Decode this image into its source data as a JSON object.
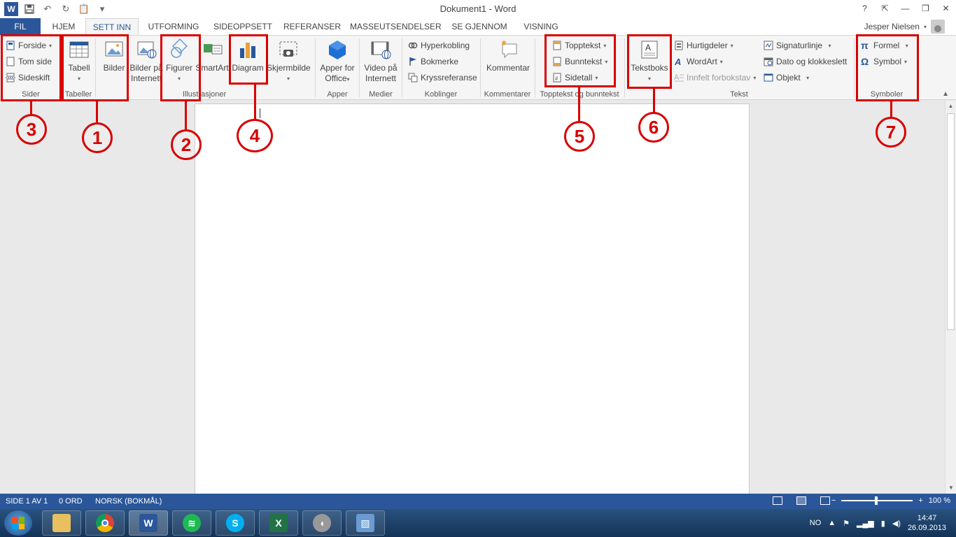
{
  "titlebar": {
    "title": "Dokument1 - Word",
    "help": "?",
    "min": "—",
    "restore": "❐",
    "close": "✕"
  },
  "tabs": {
    "file": "FIL",
    "items": [
      "HJEM",
      "SETT INN",
      "UTFORMING",
      "SIDEOPPSETT",
      "REFERANSER",
      "MASSEUTSENDELSER",
      "SE GJENNOM",
      "VISNING"
    ],
    "active": "SETT INN",
    "user": "Jesper Nielsen"
  },
  "ribbon": {
    "sider": {
      "label": "Sider",
      "forside": "Forside",
      "tom_side": "Tom side",
      "sideskift": "Sideskift"
    },
    "tabeller": {
      "label": "Tabeller",
      "tabell": "Tabell"
    },
    "illustrasjoner": {
      "label": "Illustrasjoner",
      "bilder": "Bilder",
      "bilder_pa": "Bilder på",
      "internett": "Internett",
      "figurer": "Figurer",
      "smartart": "SmartArt",
      "diagram": "Diagram",
      "skjermbilde": "Skjermbilde"
    },
    "apper": {
      "label": "Apper",
      "apper_for": "Apper for",
      "office": "Office"
    },
    "medier": {
      "label": "Medier",
      "video_pa": "Video på",
      "internett": "Internett"
    },
    "koblinger": {
      "label": "Koblinger",
      "hyperkobling": "Hyperkobling",
      "bokmerke": "Bokmerke",
      "kryssreferanse": "Kryssreferanse"
    },
    "kommentarer": {
      "label": "Kommentarer",
      "kommentar": "Kommentar"
    },
    "topptekst": {
      "label": "Topptekst og bunntekst",
      "topptekst": "Topptekst",
      "bunntekst": "Bunntekst",
      "sidetall": "Sidetall"
    },
    "tekst": {
      "label": "Tekst",
      "tekstboks": "Tekstboks",
      "hurtigdeler": "Hurtigdeler",
      "wordart": "WordArt",
      "innfelt": "Innfelt forbokstav",
      "signaturlinje": "Signaturlinje",
      "dato": "Dato og klokkeslett",
      "objekt": "Objekt"
    },
    "symboler": {
      "label": "Symboler",
      "formel": "Formel",
      "symbol": "Symbol"
    }
  },
  "annotations": [
    "1",
    "2",
    "3",
    "4",
    "5",
    "6",
    "7"
  ],
  "status": {
    "page": "SIDE 1 AV 1",
    "words": "0 ORD",
    "language": "NORSK (BOKMÅL)",
    "zoom": "100 %"
  },
  "taskbar": {
    "lang": "NO",
    "time": "14:47",
    "date": "26.09.2013"
  },
  "colors": {
    "word_blue": "#2b579a",
    "annotation_red": "#d80000"
  }
}
